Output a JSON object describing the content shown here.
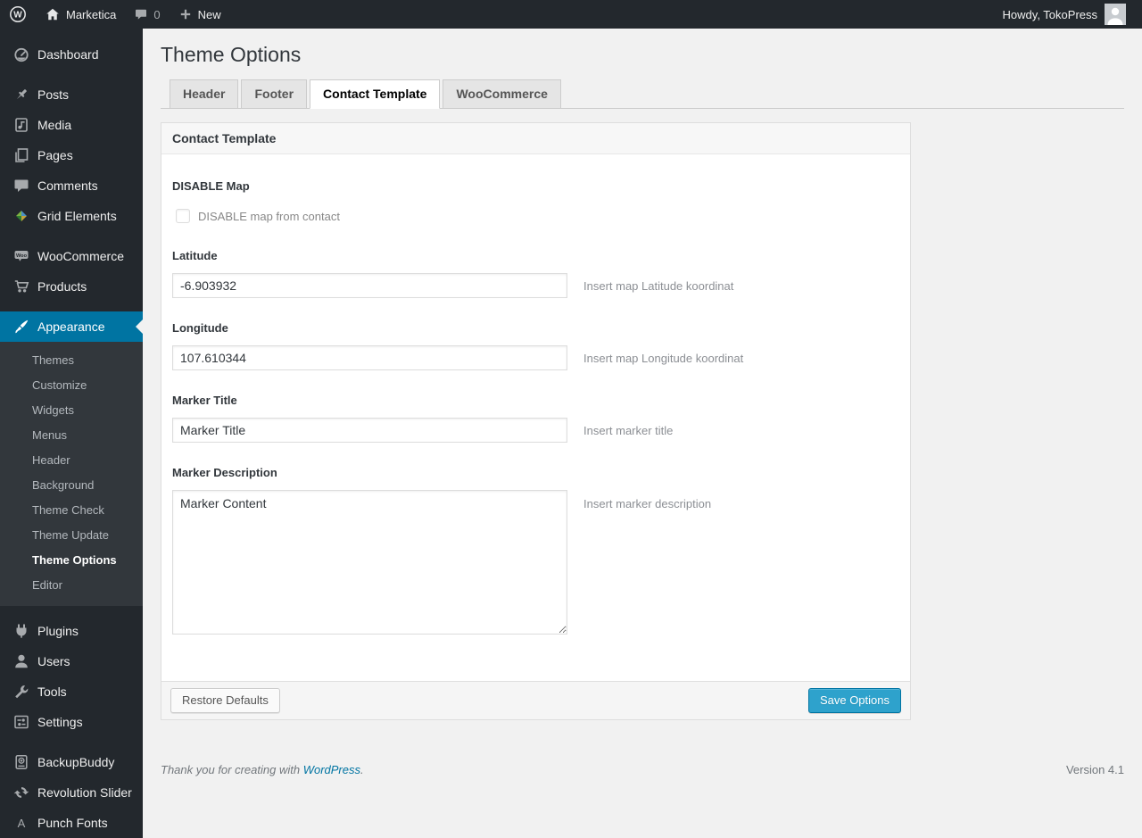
{
  "admin_bar": {
    "wp_logo_glyph": "W",
    "site_name": "Marketica",
    "comment_count": "0",
    "new_label": "New",
    "howdy": "Howdy, TokoPress"
  },
  "sidebar": {
    "dashboard": "Dashboard",
    "posts": "Posts",
    "media": "Media",
    "pages": "Pages",
    "comments": "Comments",
    "grid_elements": "Grid Elements",
    "woocommerce": "WooCommerce",
    "woo_badge": "Woo",
    "products": "Products",
    "appearance": "Appearance",
    "submenu": {
      "themes": "Themes",
      "customize": "Customize",
      "widgets": "Widgets",
      "menus": "Menus",
      "header": "Header",
      "background": "Background",
      "theme_check": "Theme Check",
      "theme_update": "Theme Update",
      "theme_options": "Theme Options",
      "editor": "Editor"
    },
    "plugins": "Plugins",
    "users": "Users",
    "tools": "Tools",
    "settings": "Settings",
    "backupbuddy": "BackupBuddy",
    "revolution_slider": "Revolution Slider",
    "punch_fonts": "Punch Fonts",
    "punch_fonts_glyph": "A"
  },
  "page": {
    "title": "Theme Options",
    "tabs": {
      "header": "Header",
      "footer": "Footer",
      "contact_template": "Contact Template",
      "woocommerce": "WooCommerce",
      "active": "Contact Template"
    },
    "panel": {
      "title": "Contact Template",
      "disable_map": {
        "label": "DISABLE Map",
        "checkbox_label": "DISABLE map from contact",
        "checked": false
      },
      "latitude": {
        "label": "Latitude",
        "value": "-6.903932",
        "help": "Insert map Latitude koordinat"
      },
      "longitude": {
        "label": "Longitude",
        "value": "107.610344",
        "help": "Insert map Longitude koordinat"
      },
      "marker_title": {
        "label": "Marker Title",
        "value": "Marker Title",
        "help": "Insert marker title"
      },
      "marker_description": {
        "label": "Marker Description",
        "value": "Marker Content",
        "help": "Insert marker description"
      },
      "restore_button": "Restore Defaults",
      "save_button": "Save Options"
    },
    "page_footer": {
      "thanks_text": "Thank you for creating with",
      "wordpress_link": "WordPress",
      "period": ".",
      "version": "Version 4.1"
    }
  },
  "colors": {
    "admin_bar_bg": "#23282d",
    "menu_bg": "#23282d",
    "submenu_bg": "#32373c",
    "menu_highlight": "#0074a2",
    "page_bg": "#f1f1f1",
    "primary_button_bg": "#2ea2cc",
    "primary_button_border": "#0074a2",
    "link": "#0074a2"
  }
}
